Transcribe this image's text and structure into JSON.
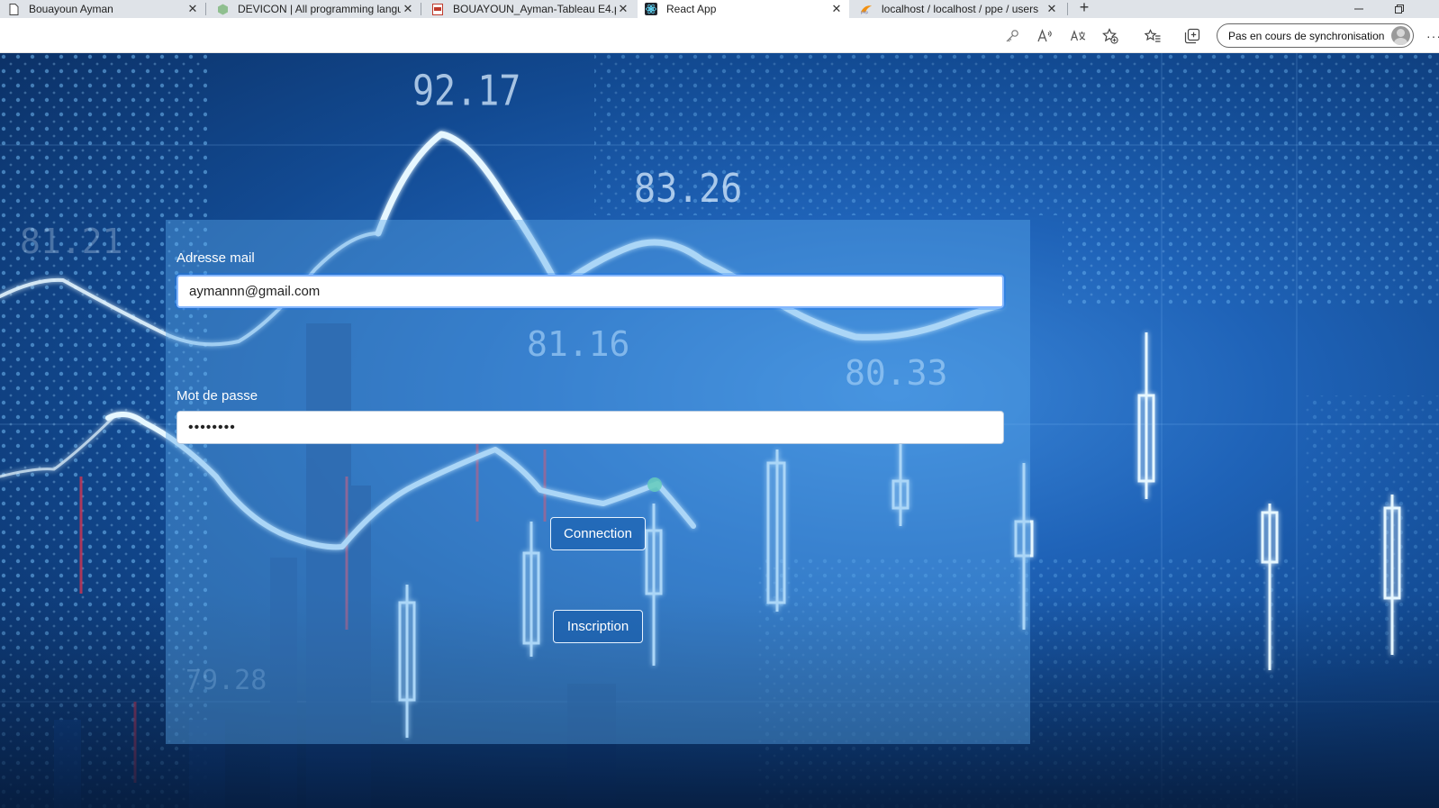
{
  "browser": {
    "tabs": [
      {
        "title": "Bouayoun Ayman",
        "active": false,
        "icon": "document-icon"
      },
      {
        "title": "DEVICON | All programming langu",
        "active": false,
        "icon": "devicon-icon"
      },
      {
        "title": "BOUAYOUN_Ayman-Tableau E4.pdf",
        "active": false,
        "icon": "pdf-icon"
      },
      {
        "title": "React App",
        "active": true,
        "icon": "react-icon"
      },
      {
        "title": "localhost / localhost / ppe / users",
        "active": false,
        "icon": "phpmyadmin-icon"
      }
    ],
    "close_glyph": "✕",
    "new_tab_glyph": "+",
    "sync_label": "Pas en cours de synchronisation",
    "more_glyph": "···",
    "toolbar_icons": [
      "key-icon",
      "read-aloud-icon",
      "translate-icon",
      "add-favorite-icon",
      "favorites-icon",
      "collections-icon"
    ]
  },
  "background": {
    "chart_numbers": [
      "92.17",
      "83.26",
      "81.21",
      "81.16",
      "80.33",
      "79.28"
    ],
    "colors": {
      "glow": "#d9f3ff",
      "dots": "#7cc6ff",
      "accent_dot": "#6fe39a"
    }
  },
  "form": {
    "email_label": "Adresse mail",
    "email_value": "aymannn@gmail.com",
    "password_label": "Mot de passe",
    "password_value": "••••••••",
    "connect_button": "Connection",
    "signup_button": "Inscription"
  },
  "colors": {
    "panel": "#5aaaeb",
    "focus_ring": "#86b7fe",
    "tabstrip": "#dfe3e8"
  }
}
